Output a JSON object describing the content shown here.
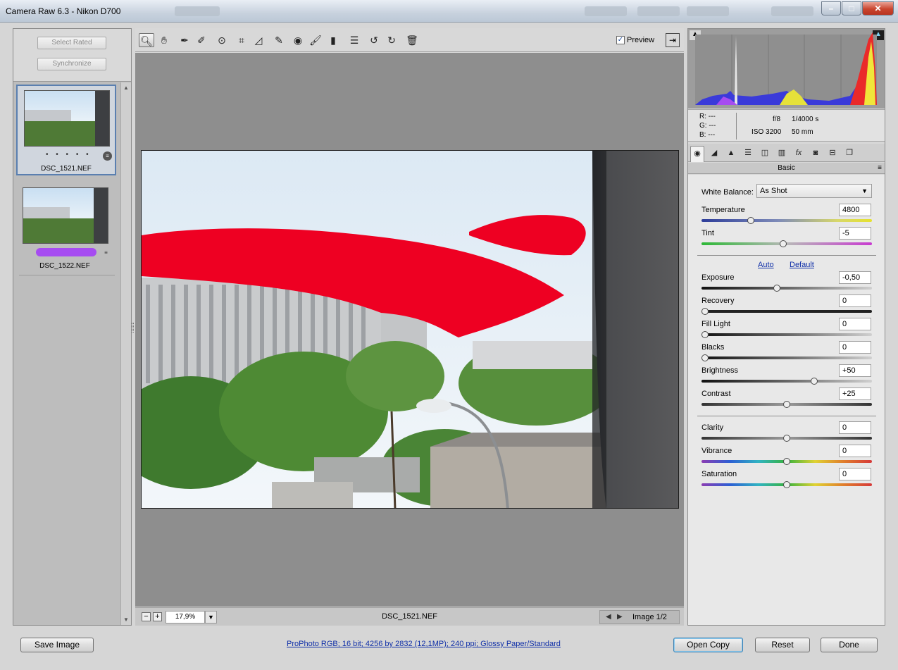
{
  "window": {
    "title": "Camera Raw 6.3  -  Nikon D700"
  },
  "filmstrip": {
    "select_rated": "Select Rated",
    "synchronize": "Synchronize",
    "items": [
      {
        "name": "DSC_1521.NEF",
        "rating": "• • • • •",
        "selected": true
      },
      {
        "name": "DSC_1522.NEF",
        "label_color": "#a64cf1",
        "selected": false
      }
    ]
  },
  "toolbar": {
    "tools": [
      "zoom-tool",
      "hand-tool",
      "white-balance-tool",
      "color-sampler-tool",
      "targeted-adjustment-tool",
      "crop-tool",
      "straighten-tool",
      "spot-removal-tool",
      "red-eye-removal-tool",
      "adjustment-brush-tool",
      "graduated-filter-tool",
      "open-preferences",
      "rotate-left",
      "rotate-right",
      "trash"
    ],
    "preview_label": "Preview",
    "preview_checked": true
  },
  "preview": {
    "zoom_level": "17,9%",
    "filename": "DSC_1521.NEF",
    "image_count": "Image 1/2",
    "clipping_color": "#ee0022"
  },
  "histogram": {
    "r": "R:  ---",
    "g": "G:  ---",
    "b": "B:  ---",
    "aperture": "f/8",
    "shutter": "1/4000 s",
    "iso": "ISO 3200",
    "focal": "50 mm"
  },
  "panel": {
    "title": "Basic",
    "tabs": [
      "basic",
      "tone-curve",
      "detail",
      "hsl-grayscale",
      "split-toning",
      "lens-corrections",
      "effects",
      "camera-calibration",
      "presets",
      "snapshots"
    ],
    "white_balance_label": "White Balance:",
    "white_balance_value": "As Shot",
    "auto_label": "Auto",
    "default_label": "Default",
    "sliders": [
      {
        "key": "temperature",
        "label": "Temperature",
        "value": "4800",
        "pos": 0.28
      },
      {
        "key": "tint",
        "label": "Tint",
        "value": "-5",
        "pos": 0.48
      },
      {
        "key": "exposure",
        "label": "Exposure",
        "value": "-0,50",
        "pos": 0.44
      },
      {
        "key": "recovery",
        "label": "Recovery",
        "value": "0",
        "pos": 0.0
      },
      {
        "key": "fill_light",
        "label": "Fill Light",
        "value": "0",
        "pos": 0.0
      },
      {
        "key": "blacks",
        "label": "Blacks",
        "value": "0",
        "pos": 0.0
      },
      {
        "key": "brightness",
        "label": "Brightness",
        "value": "+50",
        "pos": 0.67
      },
      {
        "key": "contrast",
        "label": "Contrast",
        "value": "+25",
        "pos": 0.5
      },
      {
        "key": "clarity",
        "label": "Clarity",
        "value": "0",
        "pos": 0.5
      },
      {
        "key": "vibrance",
        "label": "Vibrance",
        "value": "0",
        "pos": 0.5
      },
      {
        "key": "saturation",
        "label": "Saturation",
        "value": "0",
        "pos": 0.5
      }
    ]
  },
  "footer": {
    "save_image": "Save Image",
    "workflow": "ProPhoto RGB; 16 bit; 4256 by 2832 (12,1MP); 240 ppi; Glossy Paper/Standard",
    "open_copy": "Open Copy",
    "reset": "Reset",
    "done": "Done"
  }
}
